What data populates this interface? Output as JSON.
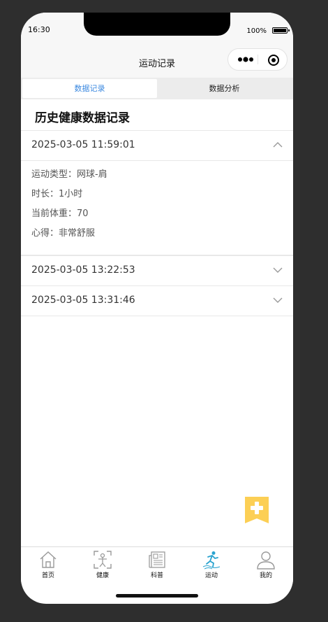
{
  "status_bar": {
    "time": "16:30",
    "battery": "100%"
  },
  "nav": {
    "title": "运动记录"
  },
  "tabs": [
    {
      "label": "数据记录",
      "active": true
    },
    {
      "label": "数据分析",
      "active": false
    }
  ],
  "page_title": "历史健康数据记录",
  "records": [
    {
      "date": "2025-03-05 11:59:01",
      "expanded": true,
      "details": [
        "运动类型：网球-肩",
        "时长：1小时",
        "当前体重：70",
        "心得：非常舒服"
      ]
    },
    {
      "date": "2025-03-05 13:22:53",
      "expanded": false
    },
    {
      "date": "2025-03-05 13:31:46",
      "expanded": false
    }
  ],
  "fab": {
    "icon": "add-bookmark-icon",
    "color": "#fccf55"
  },
  "tabbar": [
    {
      "label": "首页",
      "icon": "home-icon",
      "active": false
    },
    {
      "label": "健康",
      "icon": "body-scan-icon",
      "active": false
    },
    {
      "label": "科普",
      "icon": "newspaper-icon",
      "active": false
    },
    {
      "label": "运动",
      "icon": "running-icon",
      "active": true
    },
    {
      "label": "我的",
      "icon": "profile-icon",
      "active": false
    }
  ],
  "colors": {
    "accent": "#3d8ae0",
    "active_icon": "#2aa3cf",
    "inactive_icon": "#9a9a9a"
  }
}
